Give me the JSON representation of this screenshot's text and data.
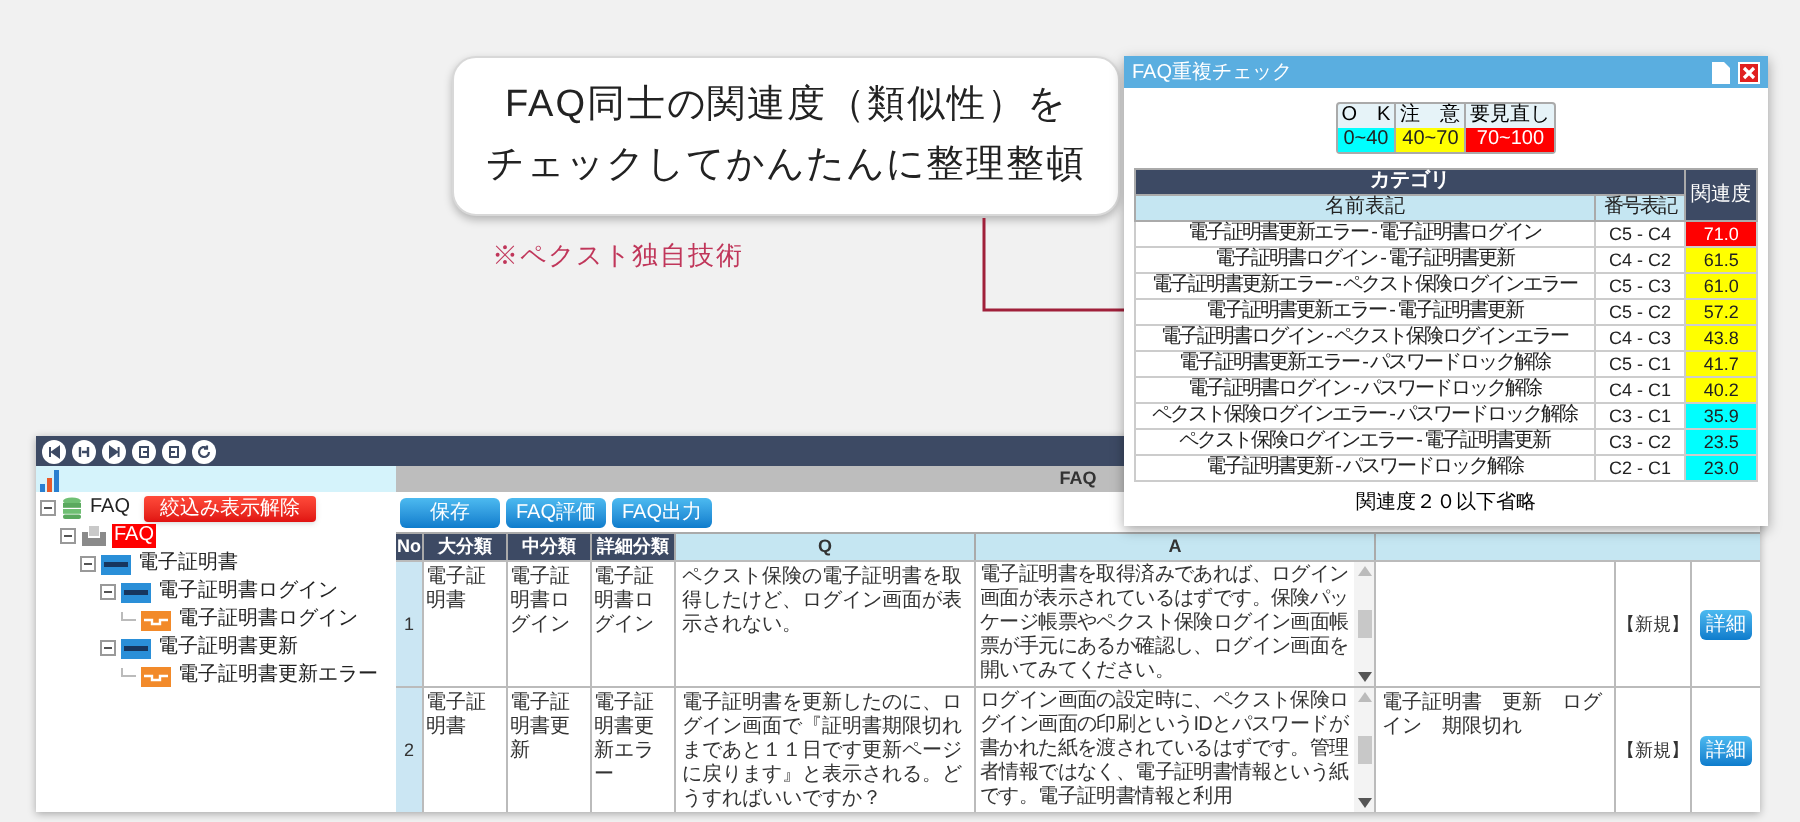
{
  "callout": {
    "lines": [
      "FAQ同士の関連度（類似性）を",
      "チェックしてかんたんに整理整頓"
    ]
  },
  "note": "※ペクスト独自技術",
  "popup": {
    "title": "FAQ重複チェック",
    "legend": [
      {
        "label": "O　K",
        "range": "0~40",
        "color": "#00ffff"
      },
      {
        "label": "注　意",
        "range": "40~70",
        "color": "#ffff00"
      },
      {
        "label": "要見直し",
        "range": "70~100",
        "color": "#ff0000"
      }
    ],
    "table": {
      "group_header": "カテゴリ",
      "columns": [
        "名前表記",
        "番号表記",
        "関連度"
      ],
      "rows": [
        {
          "name": "電子証明書更新エラー - 電子証明書ログイン",
          "code": "C5 - C4",
          "score": "71.0",
          "color": "#ff0000"
        },
        {
          "name": "電子証明書ログイン - 電子証明書更新",
          "code": "C4 - C2",
          "score": "61.5",
          "color": "#ffff00"
        },
        {
          "name": "電子証明書更新エラー - ペクスト保険ログインエラー",
          "code": "C5 - C3",
          "score": "61.0",
          "color": "#ffff00"
        },
        {
          "name": "電子証明書更新エラー - 電子証明書更新",
          "code": "C5 - C2",
          "score": "57.2",
          "color": "#ffff00"
        },
        {
          "name": "電子証明書ログイン - ペクスト保険ログインエラー",
          "code": "C4 - C3",
          "score": "43.8",
          "color": "#ffff00"
        },
        {
          "name": "電子証明書更新エラー - パスワードロック解除",
          "code": "C5 - C1",
          "score": "41.7",
          "color": "#ffff00"
        },
        {
          "name": "電子証明書ログイン - パスワードロック解除",
          "code": "C4 - C1",
          "score": "40.2",
          "color": "#ffff00"
        },
        {
          "name": "ペクスト保険ログインエラー - パスワードロック解除",
          "code": "C3 - C1",
          "score": "35.9",
          "color": "#00ffff"
        },
        {
          "name": "ペクスト保険ログインエラー - 電子証明書更新",
          "code": "C3 - C2",
          "score": "23.5",
          "color": "#00ffff"
        },
        {
          "name": "電子証明書更新 - パスワードロック解除",
          "code": "C2 - C1",
          "score": "23.0",
          "color": "#00ffff"
        }
      ]
    },
    "footer": "関連度２０以下省略"
  },
  "app": {
    "filter_button": "絞込み表示解除",
    "tree": [
      {
        "label": "FAQ",
        "kind": "root",
        "selected": false,
        "children": [
          {
            "label": "FAQ",
            "kind": "folder",
            "selected": true,
            "children": [
              {
                "label": "電子証明書",
                "kind": "category",
                "selected": false,
                "children": [
                  {
                    "label": "電子証明書ログイン",
                    "kind": "category",
                    "selected": false,
                    "children": [
                      {
                        "label": "電子証明書ログイン",
                        "kind": "leaf",
                        "selected": false
                      }
                    ]
                  },
                  {
                    "label": "電子証明書更新",
                    "kind": "category",
                    "selected": false,
                    "children": [
                      {
                        "label": "電子証明書更新エラー",
                        "kind": "leaf",
                        "selected": false
                      }
                    ]
                  }
                ]
              }
            ]
          }
        ]
      }
    ],
    "panel_title": "FAQ",
    "buttons": [
      "保存",
      "FAQ評価",
      "FAQ出力"
    ],
    "columns": [
      "No",
      "大分類",
      "中分類",
      "詳細分類",
      "Q",
      "A"
    ],
    "rows": [
      {
        "no": "1",
        "major": "電子証明書",
        "middle": "電子証明書ログイン",
        "detail": "電子証明書ログイン",
        "q": "ペクスト保険の電子証明書を取得したけど、ログイン画面が表示されない。",
        "a": "電子証明書を取得済みであれば、ログイン画面が表示されているはずです。保険パッケージ帳票やペクスト保険ログイン画面帳票が手元にあるか確認し、ログイン画面を開いてみてください。",
        "status": "【新規】",
        "action": "詳細"
      },
      {
        "no": "2",
        "major": "電子証明書",
        "middle": "電子証明書更新",
        "detail": "電子証明書更新エラー",
        "q": "電子証明書を更新したのに、ログイン画面で『証明書期限切れまであと１１日です更新ページに戻ります』と表示される。どうすればいいですか？",
        "a": "ログイン画面の設定時に、ペクスト保険ログイン画面の印刷というIDとパスワードが書かれた紙を渡されているはずです。管理者情報ではなく、電子証明書情報という紙です。電子証明書情報と利用",
        "keywords": "電子証明書　更新　ログイン　期限切れ",
        "status": "【新規】",
        "action": "詳細"
      }
    ]
  }
}
